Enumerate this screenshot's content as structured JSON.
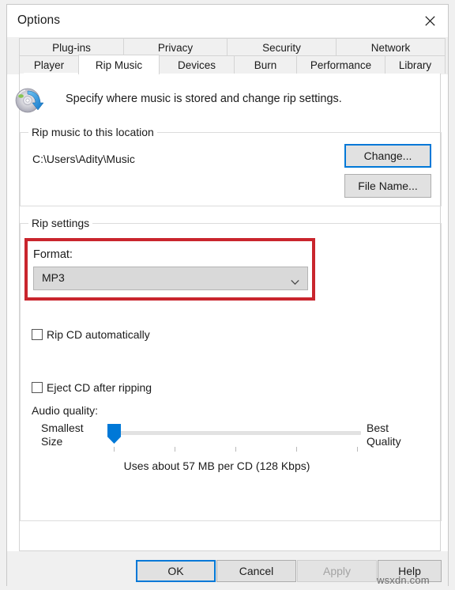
{
  "window": {
    "title": "Options",
    "close_icon": "close-icon"
  },
  "tabs": {
    "row1": [
      {
        "label": "Plug-ins",
        "selected": false
      },
      {
        "label": "Privacy",
        "selected": false
      },
      {
        "label": "Security",
        "selected": false
      },
      {
        "label": "Network",
        "selected": false
      }
    ],
    "row2": [
      {
        "label": "Player",
        "selected": false
      },
      {
        "label": "Rip Music",
        "selected": true
      },
      {
        "label": "Devices",
        "selected": false
      },
      {
        "label": "Burn",
        "selected": false
      },
      {
        "label": "Performance",
        "selected": false
      },
      {
        "label": "Library",
        "selected": false
      }
    ]
  },
  "header": {
    "icon": "cd-rip-icon",
    "description": "Specify where music is stored and change rip settings."
  },
  "location_group": {
    "legend": "Rip music to this location",
    "path": "C:\\Users\\Adity\\Music",
    "change_button": "Change...",
    "filename_button": "File Name..."
  },
  "rip_settings_group": {
    "legend": "Rip settings",
    "format_label": "Format:",
    "format_value": "MP3",
    "format_options": [
      "MP3"
    ],
    "dropdown_icon": "chevron-down-icon",
    "rip_auto": {
      "label": "Rip CD automatically",
      "checked": false
    },
    "eject_after": {
      "label": "Eject CD after ripping",
      "checked": false
    },
    "audio_quality_label": "Audio quality:",
    "slider_min_label_line1": "Smallest",
    "slider_min_label_line2": "Size",
    "slider_max_label_line1": "Best",
    "slider_max_label_line2": "Quality",
    "slider_value_percent": 0,
    "quality_note": "Uses about 57 MB per CD (128 Kbps)"
  },
  "footer": {
    "ok": "OK",
    "cancel": "Cancel",
    "apply": "Apply",
    "help": "Help"
  },
  "watermark": "wsxdn.com",
  "colors": {
    "accent": "#0078d7",
    "highlight_box": "#c9252d",
    "dialog_bg": "#f0f0f0",
    "panel_bg": "#ffffff"
  }
}
